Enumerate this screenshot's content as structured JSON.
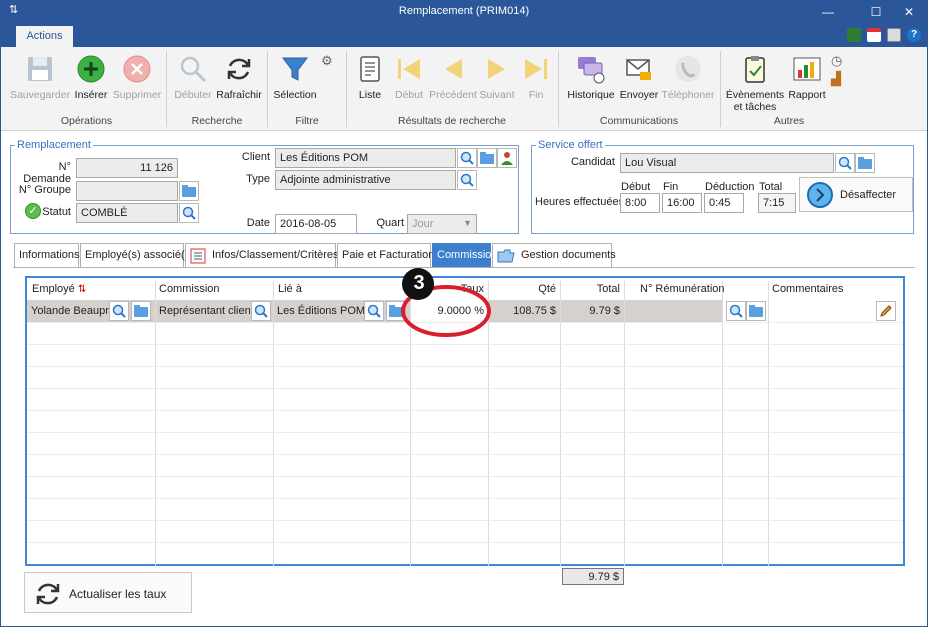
{
  "window": {
    "title": "Remplacement (PRIM014)",
    "quick_access": "⇅",
    "minimize": "—",
    "maximize": "☐",
    "close": "✕"
  },
  "ribbon_tab": "Actions",
  "ribbon": {
    "groups": [
      "Opérations",
      "Recherche",
      "Filtre",
      "Résultats de recherche",
      "Communications",
      "Autres"
    ],
    "buttons": {
      "save": "Sauvegarder",
      "insert": "Insérer",
      "delete": "Supprimer",
      "start": "Débuter",
      "refresh": "Rafraîchir",
      "selection": "Sélection",
      "list": "Liste",
      "first": "Début",
      "previous": "Précédent",
      "next": "Suivant",
      "last": "Fin",
      "history": "Historique",
      "send": "Envoyer",
      "phone": "Téléphoner",
      "events_1": "Évènements",
      "events_2": "et tâches",
      "report": "Rapport"
    }
  },
  "remplacement": {
    "legend": "Remplacement",
    "demande_label": "N° Demande",
    "demande_value": "11 126",
    "groupe_label": "N° Groupe",
    "groupe_value": "",
    "statut_label": "Statut",
    "statut_value": "COMBLÉ",
    "client_label": "Client",
    "client_value": "Les Éditions POM",
    "type_label": "Type",
    "type_value": "Adjointe administrative",
    "date_label": "Date",
    "date_value": "2016-08-05",
    "quart_label": "Quart",
    "quart_value": "Jour"
  },
  "service": {
    "legend": "Service offert",
    "candidat_label": "Candidat",
    "candidat_value": "Lou Visual",
    "heures_label": "Heures effectuées",
    "debut_label": "Début",
    "debut_value": "8:00",
    "fin_label": "Fin",
    "fin_value": "16:00",
    "deduction_label": "Déduction",
    "deduction_value": "0:45",
    "total_label": "Total",
    "total_value": "7:15",
    "desaffecter": "Désaffecter"
  },
  "tabs": [
    "Informations",
    "Employé(s) associé(s)",
    "Infos/Classement/Critères",
    "Paie et Facturation",
    "Commission",
    "Gestion documents"
  ],
  "grid": {
    "headers": {
      "employe": "Employé",
      "commission": "Commission",
      "lie": "Lié à",
      "taux": "Taux",
      "qte": "Qté",
      "total": "Total",
      "remuneration": "N° Rémunération",
      "commentaires": "Commentaires"
    },
    "rows": [
      {
        "employe": "Yolande Beaupré",
        "commission": "Représentant client",
        "lie": "Les Éditions POM",
        "taux": "9.0000 %",
        "qte": "108.75 $",
        "total": "9.79 $",
        "remuneration": "",
        "commentaires": ""
      }
    ],
    "sum_total": "9.79 $"
  },
  "callout_number": "3",
  "actualiser": "Actualiser les taux",
  "colors": {
    "brand": "#2b579a",
    "accent": "#3d7fcf",
    "callout": "#d9202a"
  }
}
